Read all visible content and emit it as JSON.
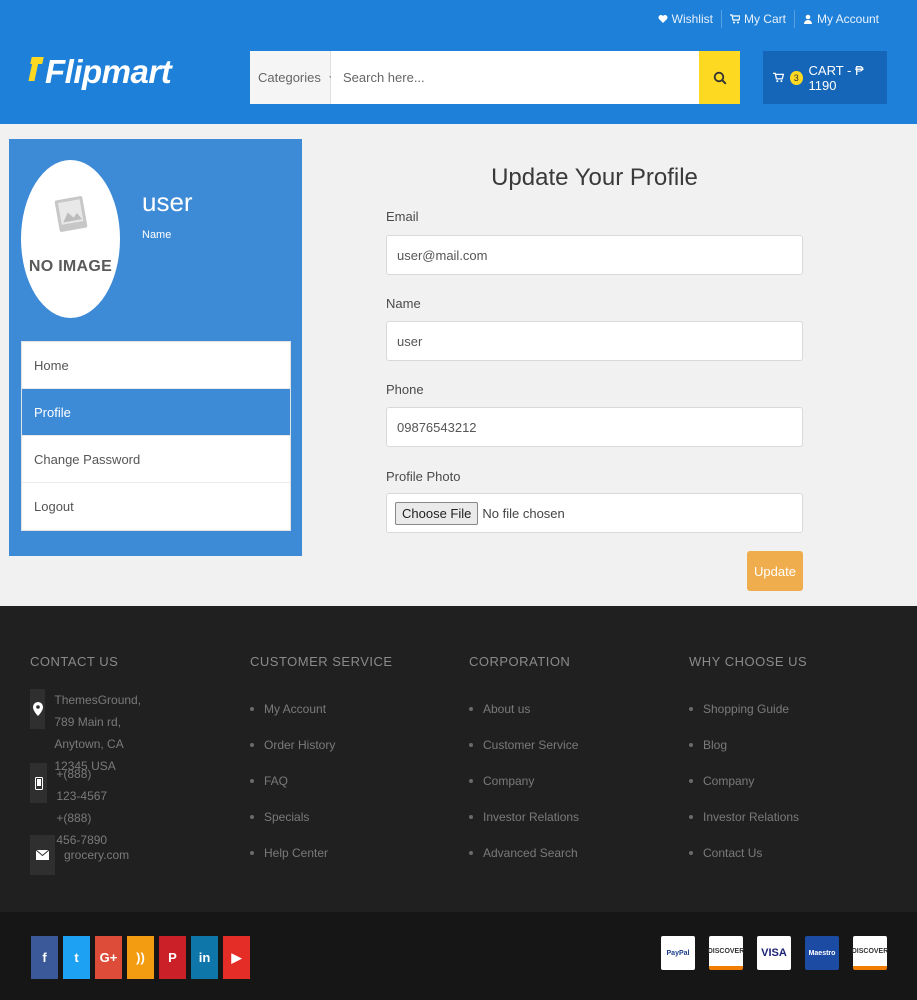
{
  "top_links": {
    "wishlist": "Wishlist",
    "my_cart": "My Cart",
    "my_account": "My Account"
  },
  "logo": {
    "text": "Flipmart"
  },
  "search": {
    "category": "Categories",
    "placeholder": "Search here..."
  },
  "cart": {
    "count": "3",
    "label": "CART - ₱ 1190"
  },
  "sidebar": {
    "no_image": "NO IMAGE",
    "user_name": "user",
    "user_label": "Name",
    "items": [
      {
        "label": "Home"
      },
      {
        "label": "Profile"
      },
      {
        "label": "Change Password"
      },
      {
        "label": "Logout"
      }
    ]
  },
  "form": {
    "title": "Update Your Profile",
    "email_label": "Email",
    "email_value": "user@mail.com",
    "name_label": "Name",
    "name_value": "user",
    "phone_label": "Phone",
    "phone_value": "09876543212",
    "photo_label": "Profile Photo",
    "choose_file": "Choose File",
    "no_file": "No file chosen",
    "update": "Update"
  },
  "footer": {
    "contact_heading": "CONTACT US",
    "address_line1": "ThemesGround, 789 Main rd,",
    "address_line2": "Anytown, CA 12345 USA",
    "phone1": "+(888) 123-4567",
    "phone2": "+(888) 456-7890",
    "email": "grocery.com",
    "customer_service_heading": "CUSTOMER SERVICE",
    "customer_service": [
      "My Account",
      "Order History",
      "FAQ",
      "Specials",
      "Help Center"
    ],
    "corporation_heading": "CORPORATION",
    "corporation": [
      "About us",
      "Customer Service",
      "Company",
      "Investor Relations",
      "Advanced Search"
    ],
    "why_heading": "WHY CHOOSE US",
    "why": [
      "Shopping Guide",
      "Blog",
      "Company",
      "Investor Relations",
      "Contact Us"
    ]
  },
  "social": [
    {
      "icon": "facebook-icon",
      "glyph": "f",
      "color": "#3b5998"
    },
    {
      "icon": "twitter-icon",
      "glyph": "t",
      "color": "#1da1f2"
    },
    {
      "icon": "google-plus-icon",
      "glyph": "G+",
      "color": "#dd4b39"
    },
    {
      "icon": "rss-icon",
      "glyph": "))",
      "color": "#f39c12"
    },
    {
      "icon": "pinterest-icon",
      "glyph": "P",
      "color": "#cb2027"
    },
    {
      "icon": "linkedin-icon",
      "glyph": "in",
      "color": "#0e76a8"
    },
    {
      "icon": "youtube-icon",
      "glyph": "▶",
      "color": "#e52d27"
    }
  ],
  "payments": [
    {
      "icon": "paypal-icon",
      "text": "PayPal"
    },
    {
      "icon": "discover-icon",
      "text": "DISCOVER"
    },
    {
      "icon": "visa-icon",
      "text": "VISA"
    },
    {
      "icon": "maestro-icon",
      "text": "Maestro"
    },
    {
      "icon": "discover-icon",
      "text": "DISCOVER"
    }
  ],
  "colors": {
    "header_blue": "#1e80d8",
    "sidebar_blue": "#3d8ad6",
    "accent_yellow": "#fdd922",
    "update_orange": "#f0ad4e",
    "footer_dark": "#202020"
  }
}
